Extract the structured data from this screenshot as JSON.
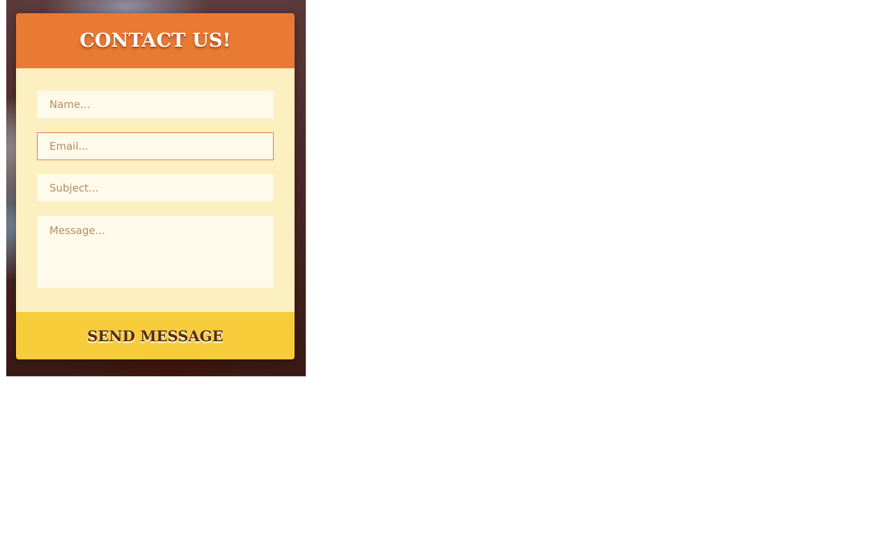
{
  "contact_form": {
    "title": "CONTACT US!",
    "fields": {
      "name_placeholder": "Name...",
      "email_placeholder": "Email...",
      "subject_placeholder": "Subject...",
      "message_placeholder": "Message..."
    },
    "submit_label": "SEND MESSAGE"
  },
  "colors": {
    "header": "#e97a34",
    "body": "#fcefc0",
    "input": "#fffaea",
    "focus_border": "#e07a4a",
    "submit": "#f6cc3b"
  }
}
